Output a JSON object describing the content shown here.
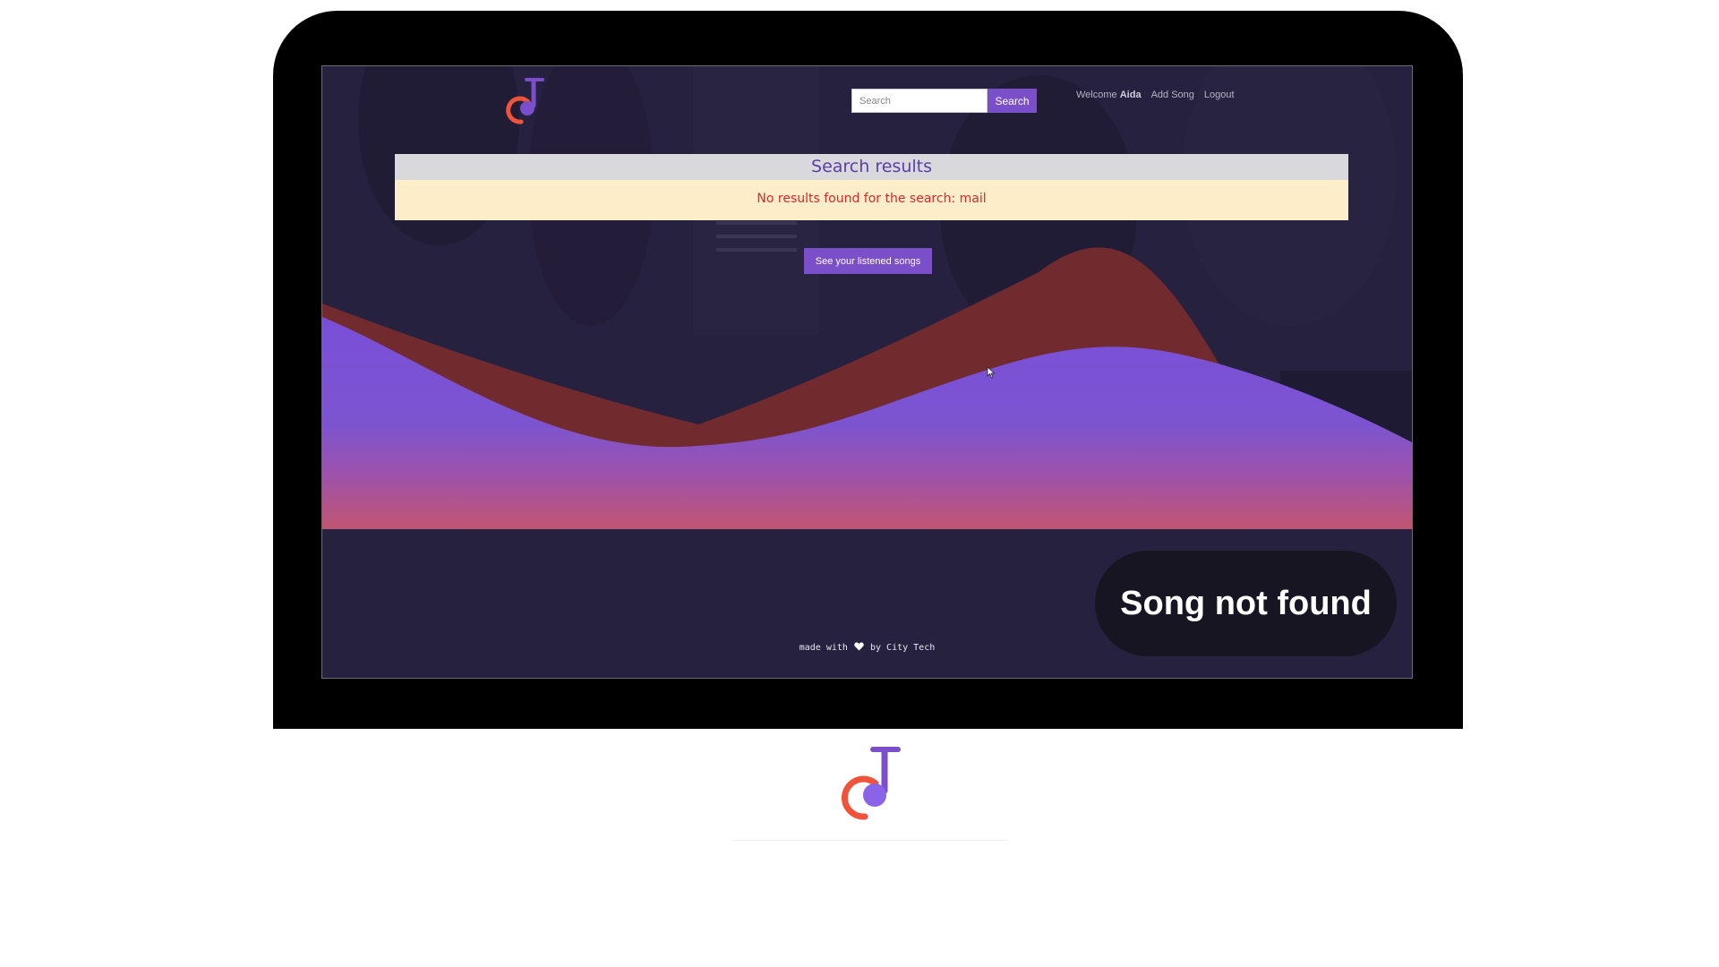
{
  "header": {
    "search_placeholder": "Search",
    "search_button": "Search",
    "welcome_prefix": "Welcome",
    "welcome_user": "Aida",
    "nav": {
      "add_song": "Add Song",
      "logout": "Logout"
    }
  },
  "results": {
    "title": "Search results",
    "message": "No results found for the search: mail"
  },
  "listened_button": "See your listened songs",
  "footer": {
    "prefix": "made with",
    "suffix": "by City Tech"
  },
  "toast": "Song not found",
  "colors": {
    "accent": "#7b4fc9",
    "background": "#25213f",
    "error_text": "#d42a2a",
    "notice_bg": "#fdedc9",
    "logo_orange": "#f0533a",
    "logo_purple": "#8a63e6"
  },
  "icons": [
    "music-note-logo-icon",
    "heart-icon",
    "mouse-cursor-icon"
  ]
}
